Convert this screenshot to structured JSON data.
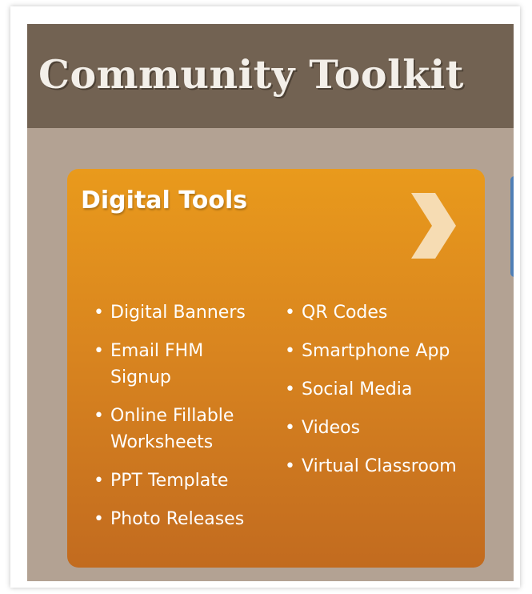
{
  "header": {
    "title": "Community Toolkit"
  },
  "card": {
    "title": "Digital Tools",
    "left_items": [
      {
        "label": "Digital Banners"
      },
      {
        "label": "Email FHM Signup"
      },
      {
        "label": "Online Fillable Worksheets"
      },
      {
        "label": "PPT Template"
      },
      {
        "label": "Photo Releases"
      }
    ],
    "right_items": [
      {
        "label": "QR Codes"
      },
      {
        "label": "Smartphone App"
      },
      {
        "label": "Social Media"
      },
      {
        "label": "Videos"
      },
      {
        "label": "Virtual Classroom"
      }
    ]
  },
  "colors": {
    "header_bg": "#726252",
    "page_bg": "#b3a293",
    "card_top": "#e99a1c",
    "card_bottom": "#c26b1f",
    "arrow": "#f6dcb3",
    "adjacent_card": "#4f7fb6"
  },
  "icons": {
    "card_arrow": "chevron-right-icon",
    "bullet": "bullet-icon"
  }
}
